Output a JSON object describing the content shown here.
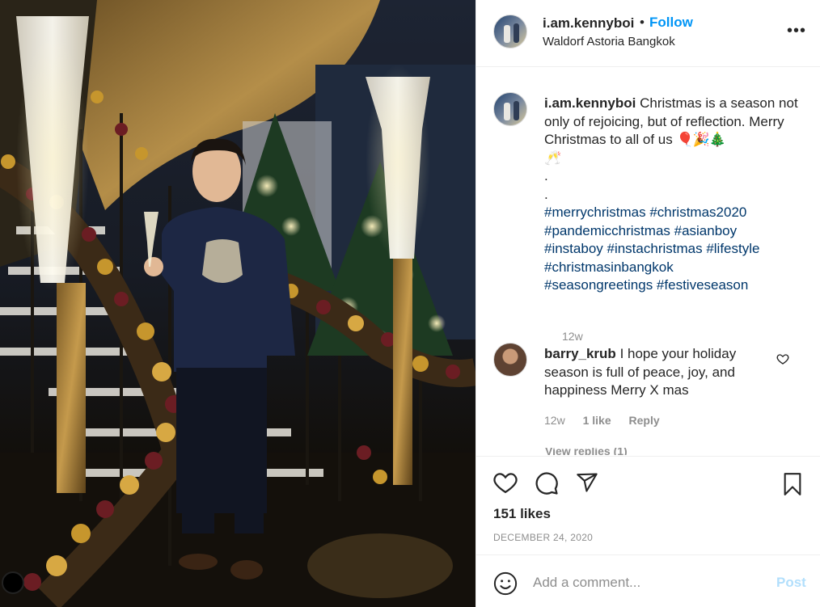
{
  "post": {
    "username": "i.am.kennyboi",
    "separator": "•",
    "follow_label": "Follow",
    "location": "Waldorf Astoria Bangkok",
    "more_label": "•••"
  },
  "caption": {
    "username": "i.am.kennyboi",
    "text": "Christmas is a season not only of rejoicing, but of reflection. Merry Christmas to all of us",
    "emojis": [
      "🎈",
      "🎉",
      "🎄",
      "🥂"
    ],
    "dots": [
      ".",
      "."
    ],
    "hashtag_lines": [
      "#merrychristmas #christmas2020",
      "#pandemicchristmas #asianboy",
      "#instaboy #instachristmas #lifestyle",
      "#christmasinbangkok",
      "#seasongreetings #festiveseason"
    ],
    "time": "12w"
  },
  "comment": {
    "username": "barry_krub",
    "text": "I hope your holiday season is full of peace, joy, and happiness Merry X mas",
    "time": "12w",
    "likes": "1 like",
    "reply_label": "Reply",
    "view_replies": "View replies (1)"
  },
  "actions": {
    "like_icon": "heart-icon",
    "comment_icon": "comment-icon",
    "share_icon": "share-icon",
    "save_icon": "bookmark-icon"
  },
  "likes": "151 likes",
  "date": "DECEMBER 24, 2020",
  "add_comment": {
    "placeholder": "Add a comment...",
    "post_label": "Post"
  },
  "colors": {
    "accent": "#0095f6",
    "hashtag": "#00376b",
    "muted": "#8e8e8e",
    "post_disabled": "#b2dffc"
  }
}
